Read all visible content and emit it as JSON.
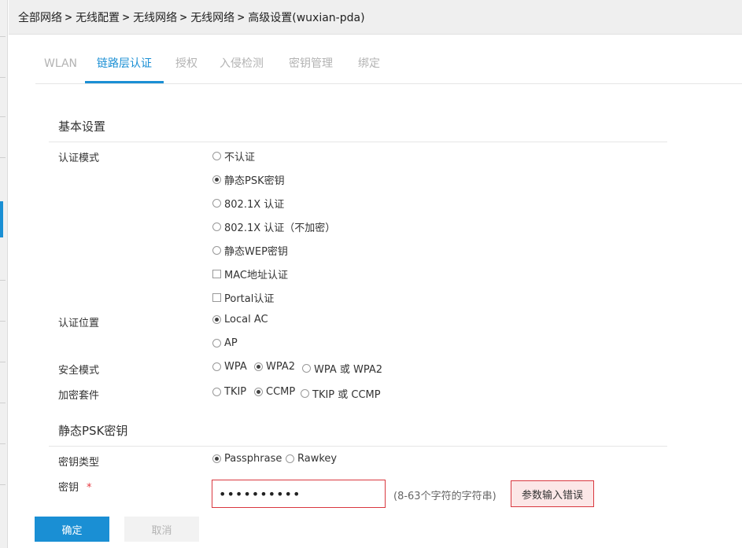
{
  "breadcrumb": [
    "全部网络",
    "无线配置",
    "无线网络",
    "无线网络",
    "高级设置(wuxian-pda)"
  ],
  "tabs": [
    {
      "label": "WLAN",
      "active": false
    },
    {
      "label": "链路层认证",
      "active": true
    },
    {
      "label": "授权",
      "active": false
    },
    {
      "label": "入侵检测",
      "active": false
    },
    {
      "label": "密钥管理",
      "active": false
    },
    {
      "label": "绑定",
      "active": false
    }
  ],
  "basic": {
    "title": "基本设置",
    "auth_mode_label": "认证模式",
    "auth_modes": [
      {
        "label": "不认证",
        "type": "radio",
        "checked": false
      },
      {
        "label": "静态PSK密钥",
        "type": "radio",
        "checked": true
      },
      {
        "label": "802.1X 认证",
        "type": "radio",
        "checked": false
      },
      {
        "label": "802.1X 认证（不加密）",
        "type": "radio",
        "checked": false
      },
      {
        "label": "静态WEP密钥",
        "type": "radio",
        "checked": false
      },
      {
        "label": "MAC地址认证",
        "type": "checkbox",
        "checked": false
      },
      {
        "label": "Portal认证",
        "type": "checkbox",
        "checked": false
      }
    ],
    "auth_location_label": "认证位置",
    "auth_locations": [
      {
        "label": "Local AC",
        "checked": true
      },
      {
        "label": "AP",
        "checked": false
      }
    ],
    "security_mode_label": "安全模式",
    "security_modes": [
      {
        "label": "WPA",
        "checked": false
      },
      {
        "label": "WPA2",
        "checked": true
      },
      {
        "label": "WPA 或 WPA2",
        "checked": false
      }
    ],
    "cipher_label": "加密套件",
    "ciphers": [
      {
        "label": "TKIP",
        "checked": false
      },
      {
        "label": "CCMP",
        "checked": true
      },
      {
        "label": "TKIP 或 CCMP",
        "checked": false
      }
    ]
  },
  "psk": {
    "title": "静态PSK密钥",
    "key_type_label": "密钥类型",
    "key_types": [
      {
        "label": "Passphrase",
        "checked": true
      },
      {
        "label": "Rawkey",
        "checked": false
      }
    ],
    "key_label": "密钥",
    "required_mark": "*",
    "key_value": "••••••••••",
    "hint": "(8-63个字符的字符串)",
    "error": "参数输入错误"
  },
  "buttons": {
    "ok": "确定",
    "cancel": "取消"
  }
}
